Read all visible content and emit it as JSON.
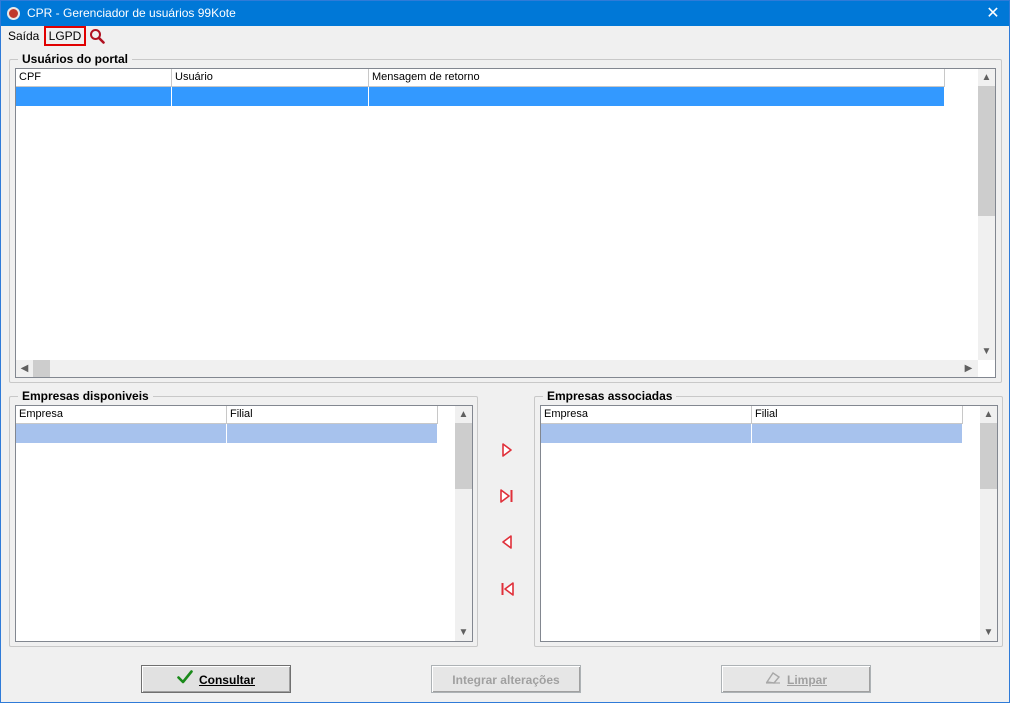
{
  "window": {
    "title": "CPR - Gerenciador de usuários 99Kote",
    "close_symbol": "✕"
  },
  "menu": {
    "saida": "Saída",
    "lgpd": "LGPD",
    "search_icon": "search-icon"
  },
  "portal_users": {
    "title": "Usuários do portal",
    "columns": [
      "CPF",
      "Usuário",
      "Mensagem de retorno"
    ],
    "selected_row_color": "#3399ff"
  },
  "available_companies": {
    "title": "Empresas disponiveis",
    "columns": [
      "Empresa",
      "Filial"
    ],
    "selected_row_color": "#a7c2ed"
  },
  "associated_companies": {
    "title": "Empresas associadas",
    "columns": [
      "Empresa",
      "Filial"
    ],
    "selected_row_color": "#a7c2ed"
  },
  "transfer_buttons": {
    "accent_color": "#e0303a",
    "icons": [
      "move-right-icon",
      "move-all-right-icon",
      "move-left-icon",
      "move-all-left-icon"
    ]
  },
  "buttons": {
    "consultar": "Consultar",
    "integrar": "Integrar alterações",
    "limpar": "Limpar"
  }
}
